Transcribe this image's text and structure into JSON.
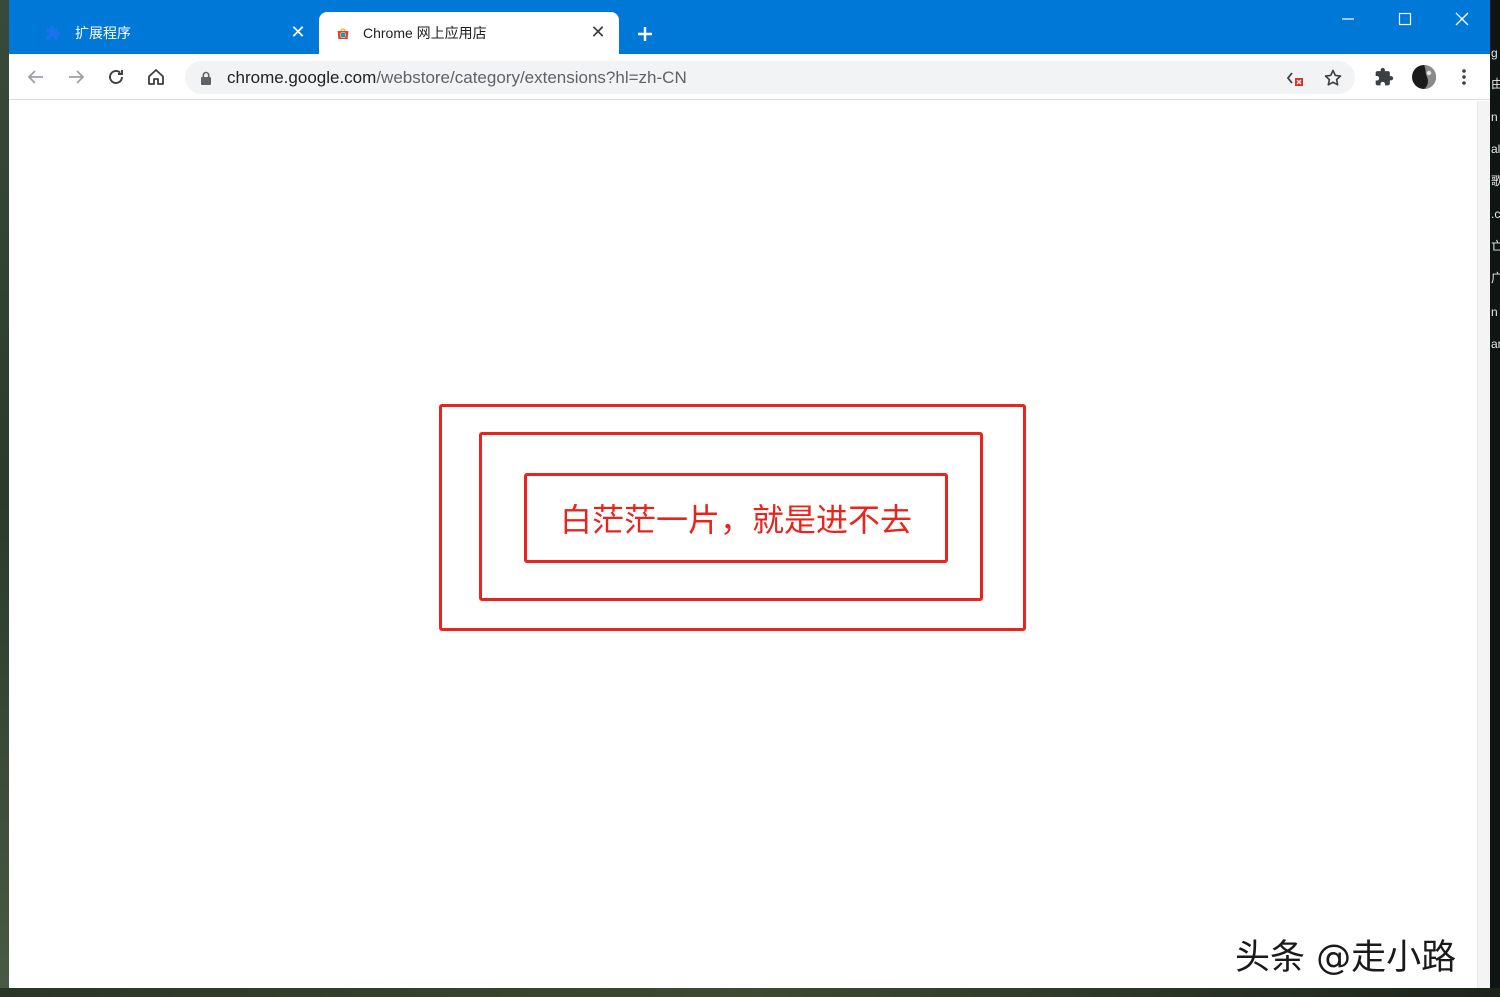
{
  "colors": {
    "titlebar": "#0078d7",
    "annotation": "#e8241c"
  },
  "tabs": [
    {
      "title": "扩展程序",
      "icon": "puzzle-icon",
      "active": false
    },
    {
      "title": "Chrome 网上应用店",
      "icon": "chrome-webstore-icon",
      "active": true
    }
  ],
  "tab_close_glyph": "✕",
  "window_controls": [
    "minimize-icon",
    "maximize-icon",
    "close-icon"
  ],
  "toolbar": {
    "buttons": [
      "back-arrow-icon",
      "forward-arrow-icon",
      "reload-icon",
      "home-icon"
    ],
    "url_host": "chrome.google.com",
    "url_path": "/webstore/category/extensions?hl=zh-CN",
    "right_icons": [
      "extensions-puzzle-icon",
      "profile-avatar-icon",
      "more-vert-icon"
    ],
    "omnibox_icons": [
      "blocked-content-icon",
      "bookmark-star-icon"
    ]
  },
  "annotation": {
    "text": "白茫茫一片，就是进不去"
  },
  "watermark": "头条 @走小路",
  "desktop_fragments": [
    "g",
    "由",
    "n",
    "al",
    "歌",
    ".c",
    "亡",
    "广",
    "n",
    "ar"
  ]
}
